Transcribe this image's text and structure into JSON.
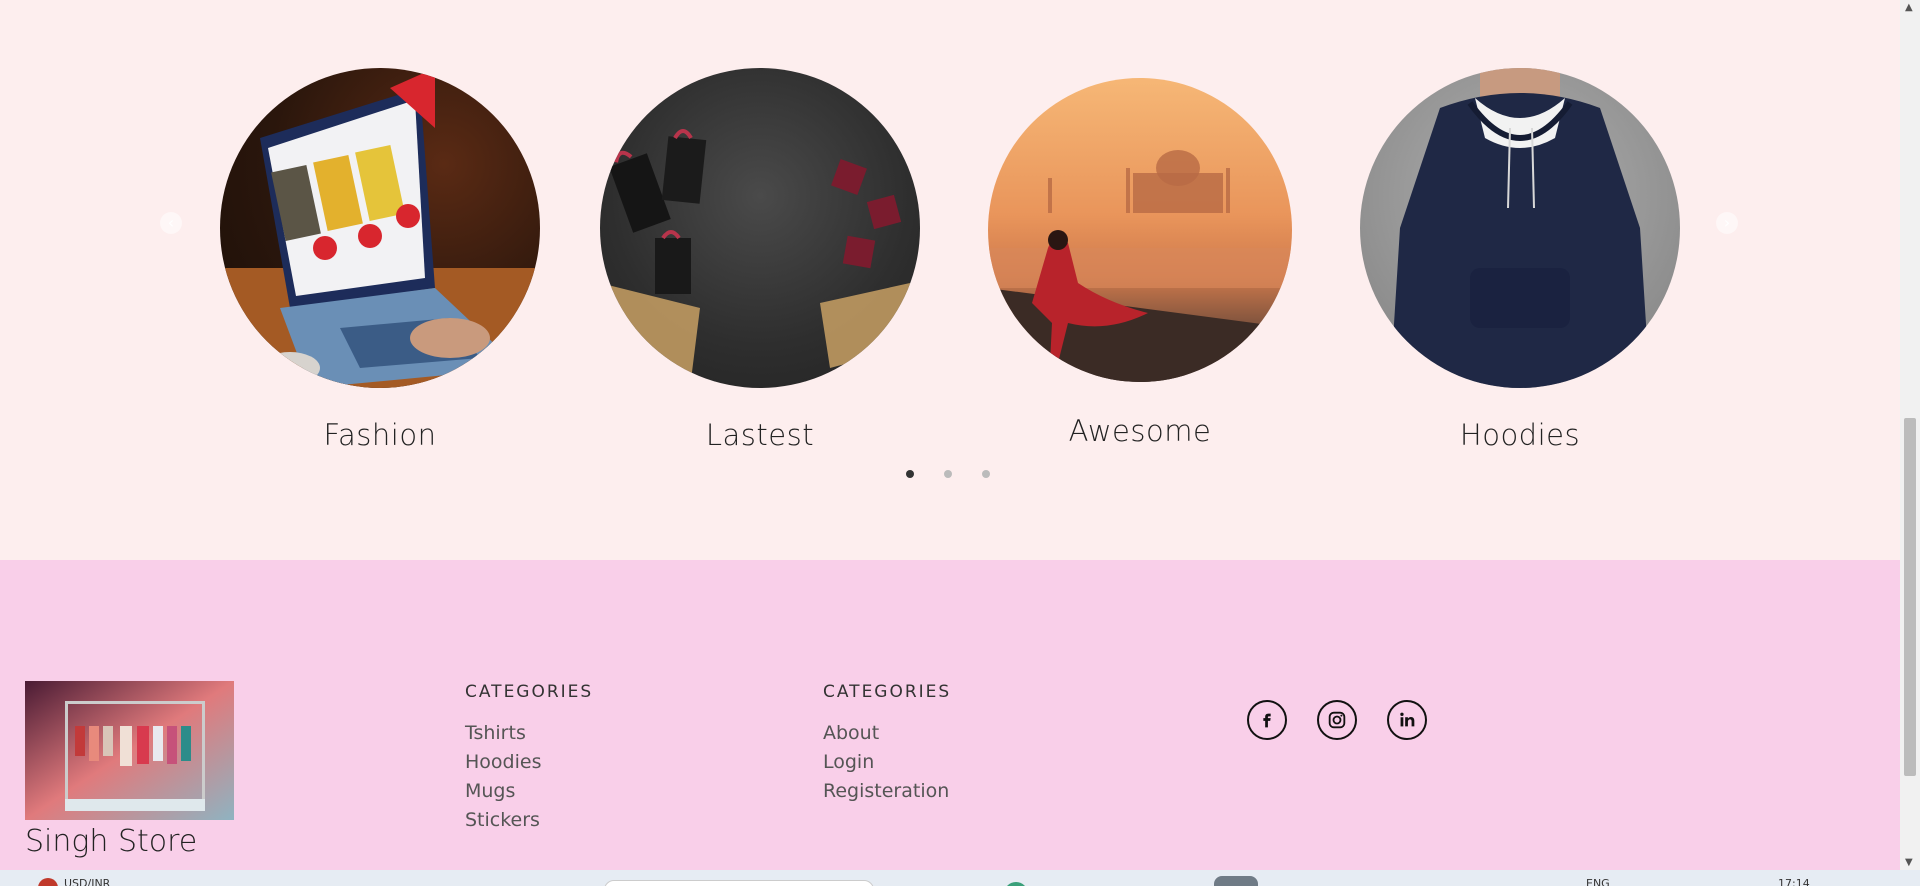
{
  "carousel": {
    "slides": [
      {
        "caption": "Fashion",
        "image": "laptop-fashion-store-photo"
      },
      {
        "caption": "Lastest",
        "image": "shopping-bags-carts-photo"
      },
      {
        "caption": "Awesome",
        "image": "taj-mahal-woman-photo"
      },
      {
        "caption": "Hoodies",
        "image": "navy-hoodie-photo"
      }
    ],
    "prev_icon": "chevron-left-icon",
    "next_icon": "chevron-right-icon",
    "dots": 3,
    "active_dot": 1
  },
  "footer": {
    "brand_name": "Singh Store",
    "brand_image": "clothing-rack-photo",
    "col1": {
      "heading": "CATEGORIES",
      "links": [
        "Tshirts",
        "Hoodies",
        "Mugs",
        "Stickers"
      ]
    },
    "col2": {
      "heading": "CATEGORIES",
      "links": [
        "About",
        "Login",
        "Registeration"
      ]
    },
    "social": [
      "facebook-icon",
      "instagram-icon",
      "linkedin-icon"
    ]
  },
  "colors": {
    "carousel_bg": "#fdeeee",
    "footer_bg": "#f9cfe9",
    "text": "#222222"
  },
  "taskbar": {
    "ticker": "USD/INR",
    "lang": "ENG",
    "time": "17:14"
  }
}
